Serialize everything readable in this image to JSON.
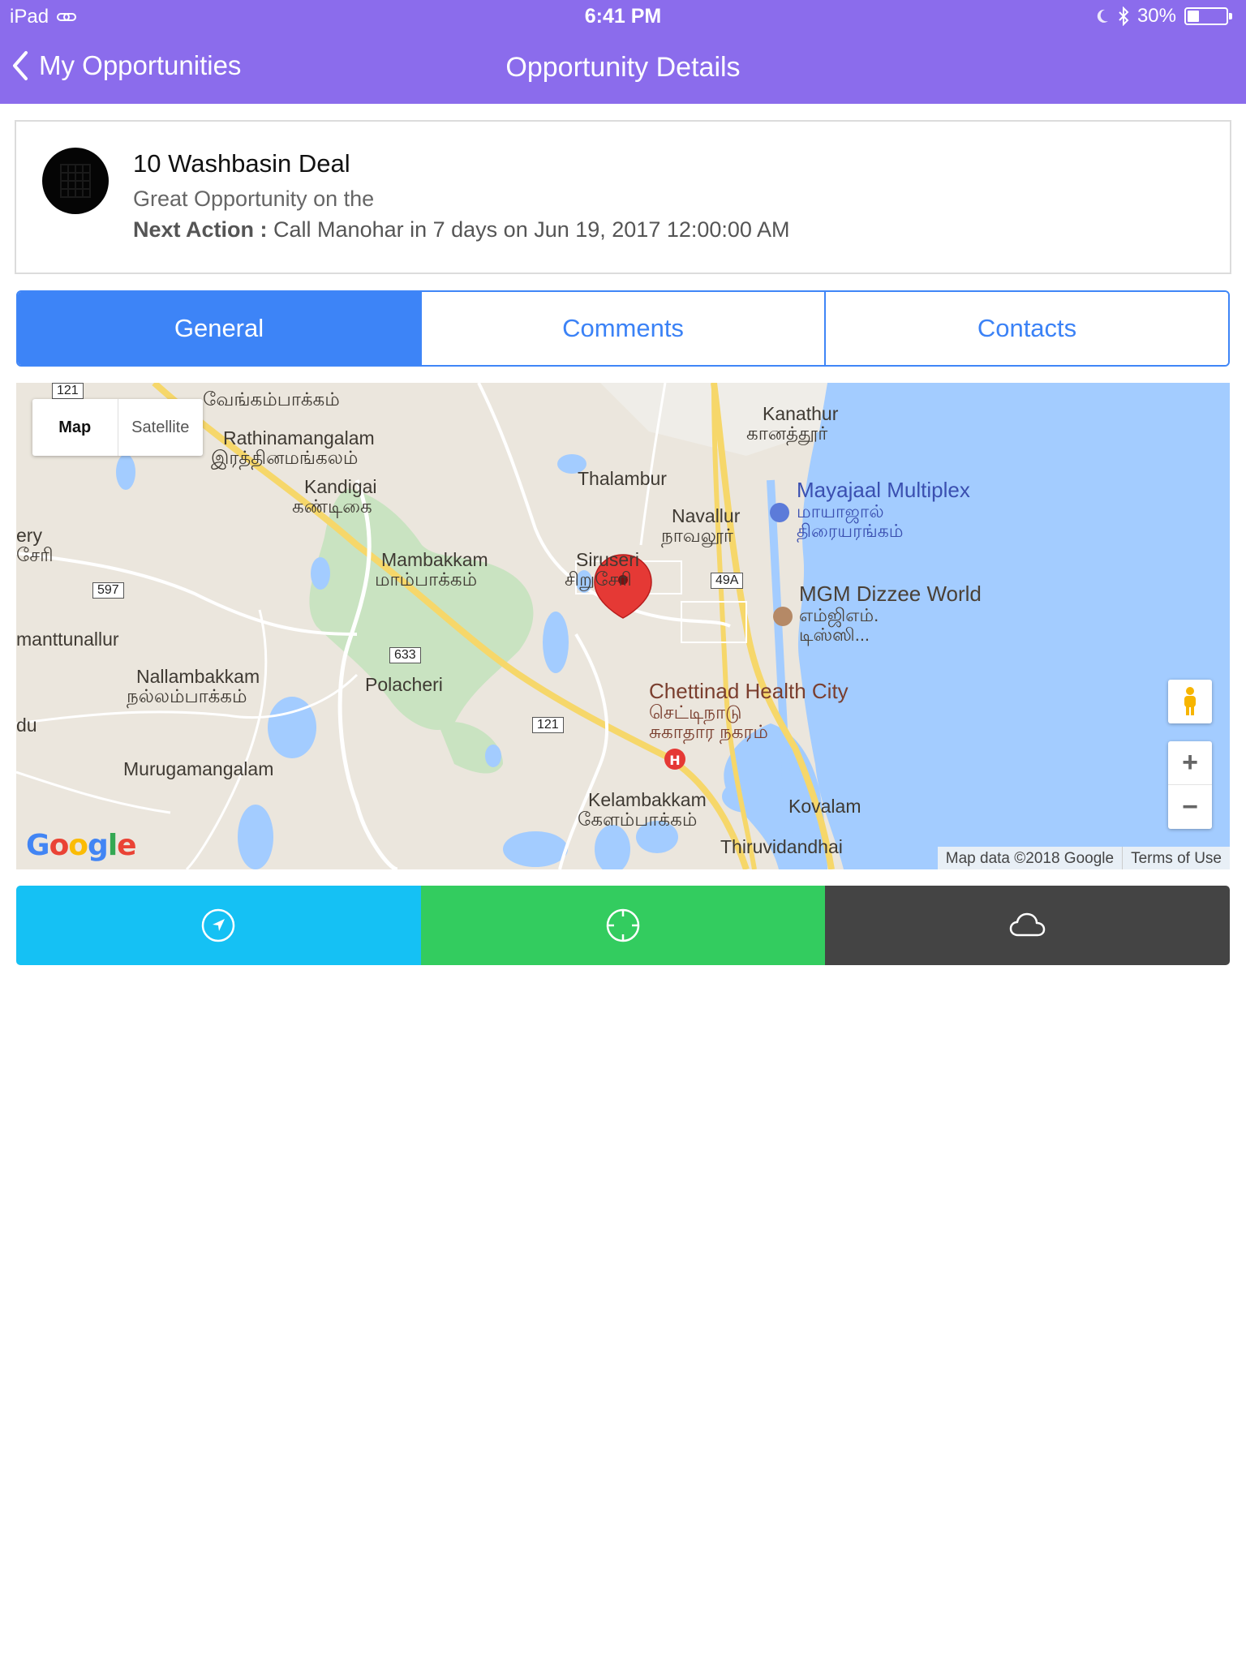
{
  "status_bar": {
    "device": "iPad",
    "time": "6:41 PM",
    "battery": "30%",
    "battery_level": 0.3
  },
  "nav": {
    "back_label": "My Opportunities",
    "title": "Opportunity Details"
  },
  "opportunity": {
    "title": "10 Washbasin Deal",
    "subtitle": "Great Opportunity on the",
    "next_action_label": "Next Action :",
    "next_action_value": "Call Manohar in 7 days on Jun 19, 2017 12:00:00 AM"
  },
  "tabs": [
    {
      "label": "General",
      "active": true
    },
    {
      "label": "Comments",
      "active": false
    },
    {
      "label": "Contacts",
      "active": false
    }
  ],
  "map": {
    "type_toggle": {
      "map": "Map",
      "satellite": "Satellite"
    },
    "labels": {
      "vengambakkam_ta": "வேங்கம்பாக்கம்",
      "rathinamangalam": "Rathinamangalam",
      "rathinamangalam_ta": "இரத்தினமங்கலம்",
      "kandigai": "Kandigai",
      "kandigai_ta": "கண்டிகை",
      "mambakkam": "Mambakkam",
      "mambakkam_ta": "மாம்பாக்கம்",
      "thalambur": "Thalambur",
      "siruseri": "Siruseri",
      "siruseri_ta": "சிறுசேரி",
      "navallur": "Navallur",
      "navallur_ta": "நாவலூர்",
      "kanathur": "Kanathur",
      "kanathur_ta": "கானத்தூர்",
      "mayajaal": "Mayajaal Multiplex",
      "mayajaal_ta1": "மாயாஜால்",
      "mayajaal_ta2": "திரையரங்கம்",
      "mgm": "MGM Dizzee World",
      "mgm_ta1": "எம்ஜிஎம்.",
      "mgm_ta2": "டிஸ்ஸி...",
      "manttunallur": "manttunallur",
      "ery": "ery",
      "ery_ta": "சேரி",
      "nallambakkam": "Nallambakkam",
      "nallambakkam_ta": "நல்லம்பாக்கம்",
      "polacheri": "Polacheri",
      "chettinad": "Chettinad Health City",
      "chettinad_ta1": "செட்டிநாடு",
      "chettinad_ta2": "சுகாதார நகரம்",
      "murugamangalam": "Murugamangalam",
      "kelambakkam": "Kelambakkam",
      "kelambakkam_ta": "கேளம்பாக்கம்",
      "kovalam": "Kovalam",
      "thiruvidandhai": "Thiruvidandhai",
      "du": "du"
    },
    "routes": [
      "121",
      "597",
      "633",
      "121",
      "49A"
    ],
    "zoom_in": "+",
    "zoom_out": "−",
    "attribution": "Map data ©2018 Google",
    "terms": "Terms of Use",
    "logo": [
      "G",
      "o",
      "o",
      "g",
      "l",
      "e"
    ]
  },
  "actions": [
    {
      "icon": "navigation-arrow-icon",
      "color": "#15c1f4"
    },
    {
      "icon": "crosshair-icon",
      "color": "#33cc5f"
    },
    {
      "icon": "cloud-icon",
      "color": "#444444"
    }
  ],
  "colors": {
    "header": "#8b6cec",
    "tab_active": "#3d84f7",
    "map_pin": "#e53935"
  }
}
